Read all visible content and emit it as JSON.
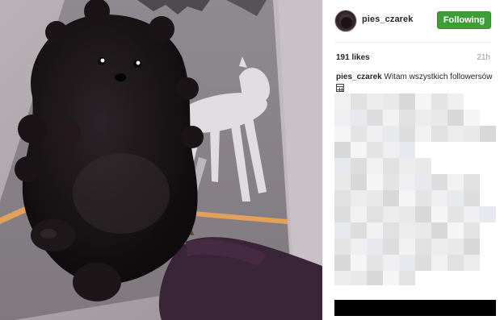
{
  "post": {
    "author": {
      "username": "pies_czarek",
      "follow_label": "Following"
    },
    "likes_text": "191 likes",
    "time_text": "21h",
    "caption": {
      "username": "pies_czarek",
      "text": "Witam wszystkich followersów"
    },
    "photo": {
      "subject": "black pomeranian puppy held up by a hand",
      "wall_art": "white bull terrier silhouette"
    }
  },
  "colors": {
    "follow_button": "#3b9f35",
    "text_primary": "#262626",
    "text_secondary": "#999999",
    "divider": "#efefef"
  },
  "icons": {
    "caption_emoji": "calendar-icon"
  }
}
